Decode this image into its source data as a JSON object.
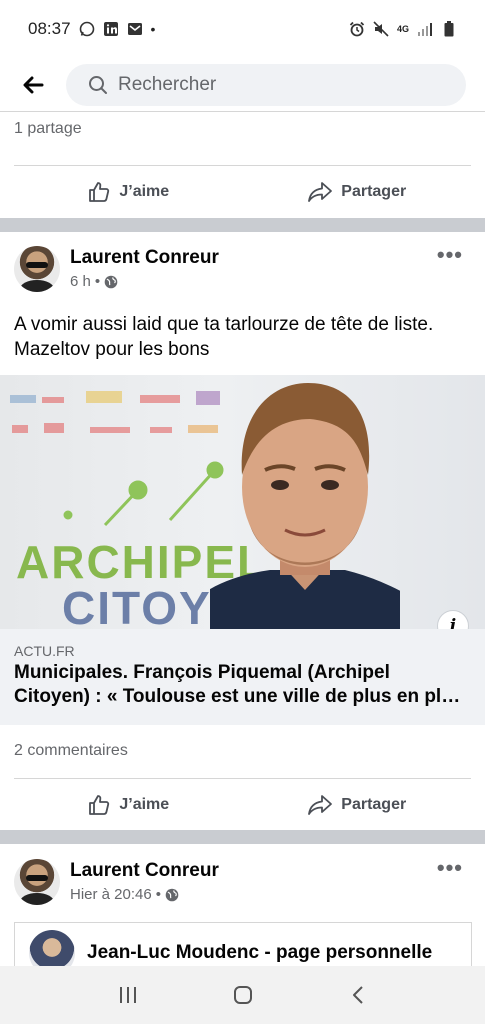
{
  "status_bar": {
    "time": "08:37",
    "network": "4G"
  },
  "search": {
    "placeholder": "Rechercher"
  },
  "previous_post": {
    "shares": "1 partage",
    "like_label": "J’aime",
    "share_label": "Partager"
  },
  "post": {
    "author": "Laurent Conreur",
    "time": "6 h",
    "text": "A vomir aussi laid que ta tarlourze de tête de liste. Mazeltov pour les bons",
    "link": {
      "domain": "ACTU.FR",
      "title": "Municipales. François Piquemal (Archipel Citoyen) : « Toulouse est une ville de plus en pl…",
      "image_text_1": "ARCHIPEL",
      "image_text_2": "CITOYEN"
    },
    "comments": "2 commentaires",
    "like_label": "J’aime",
    "share_label": "Partager"
  },
  "next_post": {
    "author": "Laurent Conreur",
    "time": "Hier à 20:46",
    "shared_page": "Jean-Luc Moudenc - page personnelle"
  },
  "colors": {
    "separator": "#c9ccd1",
    "text_secondary": "#65676b",
    "link_bg": "#f0f2f5"
  }
}
